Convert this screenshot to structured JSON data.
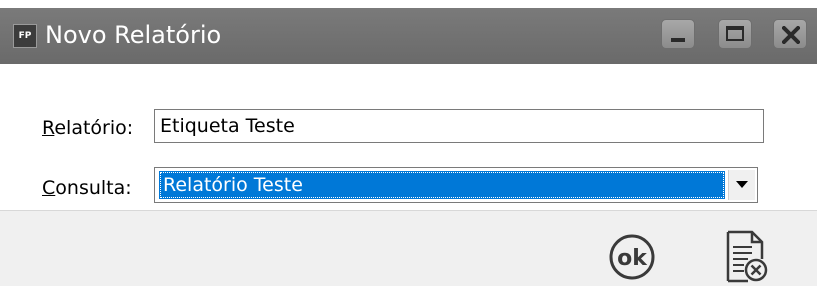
{
  "window": {
    "icon_text": "FP",
    "title": "Novo Relatório",
    "controls": {
      "minimize": "minimize-icon",
      "maximize": "maximize-icon",
      "close": "close-icon"
    }
  },
  "form": {
    "relatorio_label_accel": "R",
    "relatorio_label_rest": "elatório:",
    "relatorio_value": "Etiqueta Teste",
    "consulta_label_accel": "C",
    "consulta_label_rest": "onsulta:",
    "consulta_selected": "Relatório Teste"
  },
  "footer": {
    "ok_icon": "ok-icon",
    "ok_text": "ok",
    "cancel_icon": "cancel-document-icon"
  },
  "colors": {
    "titlebar": "#6a6a6a",
    "selection": "#0078d7"
  }
}
